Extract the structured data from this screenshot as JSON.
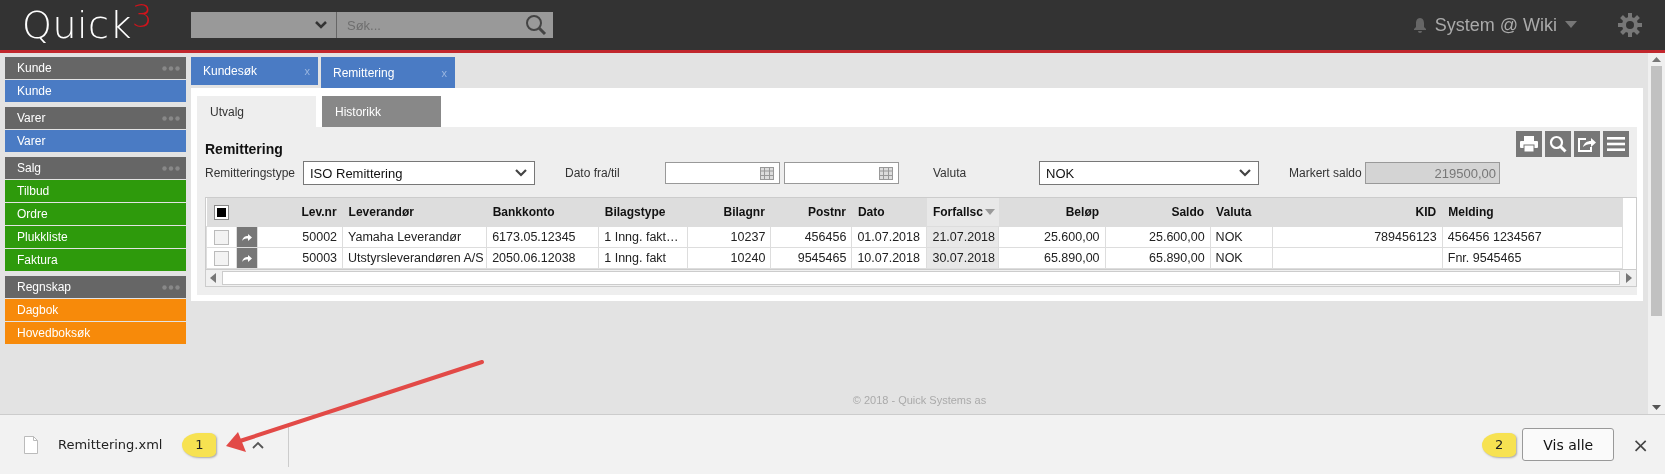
{
  "header": {
    "logo": {
      "text": "Quick",
      "accent": "3"
    },
    "search": {
      "placeholder": "Søk..."
    },
    "user": "System @ Wiki"
  },
  "sidebar": [
    {
      "title": "Kunde",
      "color": "#4a7bc4",
      "items": [
        "Kunde"
      ]
    },
    {
      "title": "Varer",
      "color": "#4a7bc4",
      "items": [
        "Varer"
      ]
    },
    {
      "title": "Salg",
      "color": "#2e9a0c",
      "items": [
        "Tilbud",
        "Ordre",
        "Plukkliste",
        "Faktura"
      ]
    },
    {
      "title": "Regnskap",
      "color": "#f78a0a",
      "items": [
        "Dagbok",
        "Hovedboksøk"
      ]
    }
  ],
  "tabs": [
    {
      "label": "Kundesøk",
      "close": "x",
      "selected": false
    },
    {
      "label": "Remittering",
      "close": "x",
      "selected": true
    }
  ],
  "subtabs": [
    {
      "label": "Utvalg",
      "selected": true
    },
    {
      "label": "Historikk",
      "selected": false
    }
  ],
  "form": {
    "title": "Remittering",
    "type_label": "Remitteringstype",
    "type_value": "ISO Remittering",
    "date_label": "Dato fra/til",
    "currency_label": "Valuta",
    "currency_value": "NOK",
    "balance_label": "Markert saldo",
    "balance_value": "219500,00"
  },
  "table": {
    "select_all": {
      "checked": true
    },
    "columns": [
      {
        "label": "Lev.nr",
        "sorted": false
      },
      {
        "label": "Leverandør",
        "sorted": false
      },
      {
        "label": "Bankkonto",
        "sorted": false
      },
      {
        "label": "Bilagstype",
        "sorted": false
      },
      {
        "label": "Bilagnr",
        "sorted": false
      },
      {
        "label": "Postnr",
        "sorted": false
      },
      {
        "label": "Dato",
        "sorted": false
      },
      {
        "label": "Forfallsc",
        "sorted": true
      },
      {
        "label": "Beløp",
        "sorted": false
      },
      {
        "label": "Saldo",
        "sorted": false
      },
      {
        "label": "Valuta",
        "sorted": false
      },
      {
        "label": "KID",
        "sorted": false
      },
      {
        "label": "Melding",
        "sorted": false
      }
    ],
    "rows": [
      {
        "checked": false,
        "cells": [
          "50002",
          "Yamaha Leverandør",
          "6173.05.12345",
          "1 Inng. fakt…",
          "10237",
          "456456",
          "01.07.2018",
          "21.07.2018",
          "25.600,00",
          "25.600,00",
          "NOK",
          "789456123",
          "456456 1234567"
        ]
      },
      {
        "checked": false,
        "cells": [
          "50003",
          "Utstyrsleverandøren A/S",
          "2050.06.12038",
          "1 Inng. fakt",
          "10240",
          "9545465",
          "10.07.2018",
          "30.07.2018",
          "65.890,00",
          "65.890,00",
          "NOK",
          "",
          "Fnr. 9545465"
        ]
      }
    ]
  },
  "footer": "© 2018 - Quick Systems as",
  "download_bar": {
    "file": "Remittering.xml",
    "show_all": "Vis alle",
    "close": "×"
  },
  "callouts": [
    "1",
    "2"
  ]
}
